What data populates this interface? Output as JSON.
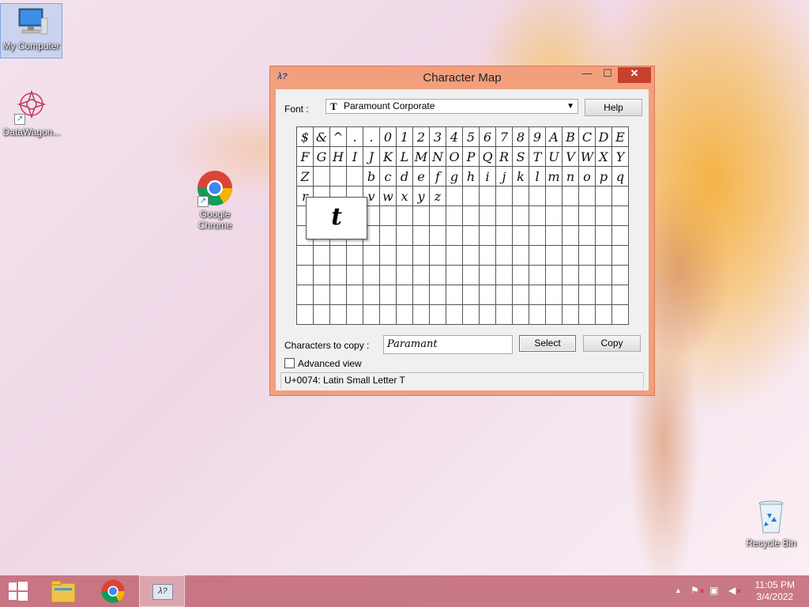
{
  "desktop": {
    "icons": [
      {
        "label": "My Computer"
      },
      {
        "label": "DataWagon..."
      },
      {
        "label": "Google Chrome"
      },
      {
        "label": "Recycle Bin"
      }
    ]
  },
  "window": {
    "title": "Character Map",
    "font_label": "Font :",
    "font_value": "Paramount Corporate",
    "font_icon": "truetype-icon",
    "help_label": "Help",
    "grid_rows": [
      [
        "$",
        "&",
        "^",
        ".",
        ".",
        "0",
        "1",
        "2",
        "3",
        "4",
        "5",
        "6",
        "7",
        "8",
        "9",
        "A",
        "B",
        "C",
        "D",
        "E"
      ],
      [
        "F",
        "G",
        "H",
        "I",
        "J",
        "K",
        "L",
        "M",
        "N",
        "O",
        "P",
        "Q",
        "R",
        "S",
        "T",
        "U",
        "V",
        "W",
        "X",
        "Y"
      ],
      [
        "Z",
        "",
        "",
        "",
        "b",
        "c",
        "d",
        "e",
        "f",
        "g",
        "h",
        "i",
        "j",
        "k",
        "l",
        "m",
        "n",
        "o",
        "p",
        "q"
      ],
      [
        "r",
        "",
        "",
        "",
        "v",
        "w",
        "x",
        "y",
        "z",
        "",
        "",
        "",
        "",
        "",
        "",
        "",
        "",
        "",
        "",
        ""
      ],
      [
        "",
        "",
        "",
        "",
        "",
        "",
        "",
        "",
        "",
        "",
        "",
        "",
        "",
        "",
        "",
        "",
        "",
        "",
        "",
        ""
      ],
      [
        "",
        "",
        "",
        "",
        "",
        "",
        "",
        "",
        "",
        "",
        "",
        "",
        "",
        "",
        "",
        "",
        "",
        "",
        "",
        ""
      ],
      [
        "",
        "",
        "",
        "",
        "",
        "",
        "",
        "",
        "",
        "",
        "",
        "",
        "",
        "",
        "",
        "",
        "",
        "",
        "",
        ""
      ],
      [
        "",
        "",
        "",
        "",
        "",
        "",
        "",
        "",
        "",
        "",
        "",
        "",
        "",
        "",
        "",
        "",
        "",
        "",
        "",
        ""
      ],
      [
        "",
        "",
        "",
        "",
        "",
        "",
        "",
        "",
        "",
        "",
        "",
        "",
        "",
        "",
        "",
        "",
        "",
        "",
        "",
        ""
      ],
      [
        "",
        "",
        "",
        "",
        "",
        "",
        "",
        "",
        "",
        "",
        "",
        "",
        "",
        "",
        "",
        "",
        "",
        "",
        "",
        ""
      ]
    ],
    "zoom_char": "t",
    "copy_label": "Characters to copy :",
    "copy_value": "Paramant",
    "select_label": "Select",
    "copy_btn_label": "Copy",
    "advanced_label": "Advanced view",
    "advanced_checked": false,
    "status": "U+0074: Latin Small Letter T"
  },
  "taskbar": {
    "items": [
      "start-button",
      "file-explorer",
      "google-chrome",
      "character-map"
    ],
    "time": "11:05 PM",
    "date": "3/4/2022"
  },
  "colors": {
    "window_frame": "#f29f7e",
    "close_button": "#c7412f",
    "taskbar": "#be5f6e"
  }
}
